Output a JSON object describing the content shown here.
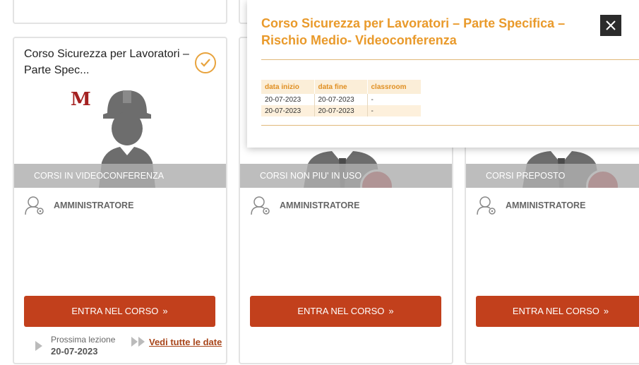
{
  "cards": [
    {
      "title": "Corso Sicurezza per Lavoratori – Parte Spec...",
      "category": "CORSI IN VIDEOCONFERENZA",
      "role": "AMMINISTRATORE",
      "enter_label": "ENTRA NEL CORSO",
      "next_lesson_label": "Prossima lezione",
      "next_lesson_date": "20-07-2023",
      "all_dates_label": "Vedi tutte le date",
      "logo_letter": "M"
    },
    {
      "category": "CORSI NON PIU' IN USO",
      "role": "AMMINISTRATORE",
      "enter_label": "ENTRA NEL CORSO"
    },
    {
      "category": "CORSI PREPOSTO",
      "role": "AMMINISTRATORE",
      "enter_label": "ENTRA NEL CORSO"
    }
  ],
  "popup": {
    "title": "Corso Sicurezza per Lavoratori – Parte Specifica – Rischio Medio- Videoconferenza",
    "columns": [
      "data inizio",
      "data fine",
      "classroom"
    ],
    "rows": [
      [
        "20-07-2023",
        "20-07-2023",
        "-"
      ],
      [
        "20-07-2023",
        "20-07-2023",
        "-"
      ]
    ]
  },
  "colors": {
    "accent_orange": "#e99a2b",
    "button_red": "#c2401c",
    "close_dark": "#2b2b2b"
  }
}
